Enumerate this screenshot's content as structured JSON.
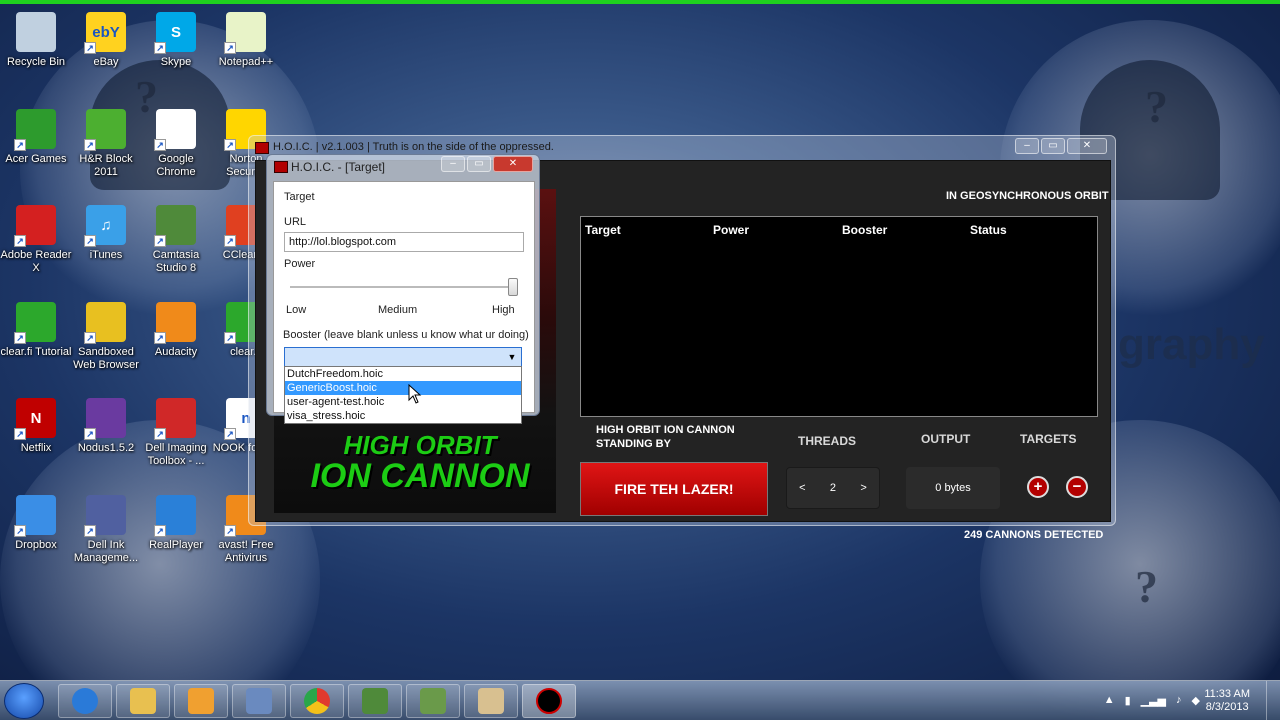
{
  "desktop": {
    "icons": [
      {
        "label": "Recycle Bin",
        "color": "#c0d0e0",
        "glyph": ""
      },
      {
        "label": "eBay",
        "color": "#ffd21f",
        "glyph": "ebY"
      },
      {
        "label": "Skype",
        "color": "#00a8e8",
        "glyph": "S"
      },
      {
        "label": "Notepad++",
        "color": "#e8f3c8",
        "glyph": ""
      },
      {
        "label": "Acer Games",
        "color": "#2d9b2d",
        "glyph": ""
      },
      {
        "label": "H&R Block 2011",
        "color": "#4caf30",
        "glyph": ""
      },
      {
        "label": "Google Chrome",
        "color": "#ffffff",
        "glyph": ""
      },
      {
        "label": "Norton Security",
        "color": "#ffd600",
        "glyph": ""
      },
      {
        "label": "Adobe Reader X",
        "color": "#d42020",
        "glyph": ""
      },
      {
        "label": "iTunes",
        "color": "#3aa0e8",
        "glyph": "♫"
      },
      {
        "label": "Camtasia Studio 8",
        "color": "#4f8a3a",
        "glyph": ""
      },
      {
        "label": "CCleaner",
        "color": "#e04020",
        "glyph": ""
      },
      {
        "label": "clear.fi Tutorial",
        "color": "#2ca82c",
        "glyph": ""
      },
      {
        "label": "Sandboxed Web Browser",
        "color": "#e8c020",
        "glyph": ""
      },
      {
        "label": "Audacity",
        "color": "#f08a1a",
        "glyph": ""
      },
      {
        "label": "clear.fi",
        "color": "#2ca82c",
        "glyph": ""
      },
      {
        "label": "Netflix",
        "color": "#c00000",
        "glyph": "N"
      },
      {
        "label": "Nodus1.5.2",
        "color": "#6a3aa0",
        "glyph": ""
      },
      {
        "label": "Dell Imaging Toolbox - ...",
        "color": "#d02828",
        "glyph": ""
      },
      {
        "label": "NOOK for PC",
        "color": "#ffffff",
        "glyph": "n"
      },
      {
        "label": "Dropbox",
        "color": "#3a8ee6",
        "glyph": ""
      },
      {
        "label": "Dell Ink Manageme...",
        "color": "#5060a0",
        "glyph": ""
      },
      {
        "label": "RealPlayer",
        "color": "#2a80d8",
        "glyph": ""
      },
      {
        "label": "avast! Free Antivirus",
        "color": "#f08a1a",
        "glyph": ""
      }
    ],
    "bg_word": "graphy"
  },
  "hoic": {
    "title": "H.O.I.C. | v2.1.003 | Truth is on the side of the oppressed.",
    "orbit_label": "IN GEOSYNCHRONOUS ORBIT",
    "art_line1": "HIGH ORBIT",
    "art_line2": "ION CANNON",
    "columns": [
      "Target",
      "Power",
      "Booster",
      "Status"
    ],
    "standby_line1": "HIGH ORBIT ION CANNON",
    "standby_line2": "STANDING BY",
    "threads_label": "THREADS",
    "output_label": "OUTPUT",
    "targets_label": "TARGETS",
    "fire_label": "FIRE TEH LAZER!",
    "threads_prev": "<",
    "threads_value": "2",
    "threads_next": ">",
    "output_value": "0 bytes",
    "add_target": "+",
    "remove_target": "−",
    "cannons_detected": "249 CANNONS DETECTED",
    "accent_color": "#1ccc14",
    "fire_color": "#d00000"
  },
  "dialog": {
    "title": "H.O.I.C. - [Target]",
    "group": "Target",
    "url_label": "URL",
    "url_value": "http://lol.blogspot.com",
    "power_label": "Power",
    "power_level": 1.0,
    "power_low": "Low",
    "power_medium": "Medium",
    "power_high": "High",
    "booster_label": "Booster (leave blank unless u know what ur doing)",
    "booster_selected": "",
    "booster_options": [
      "DutchFreedom.hoic",
      "GenericBoost.hoic",
      "user-agent-test.hoic",
      "visa_stress.hoic"
    ],
    "booster_highlight_index": 1
  },
  "taskbar": {
    "time": "11:33 AM",
    "date": "8/3/2013"
  }
}
